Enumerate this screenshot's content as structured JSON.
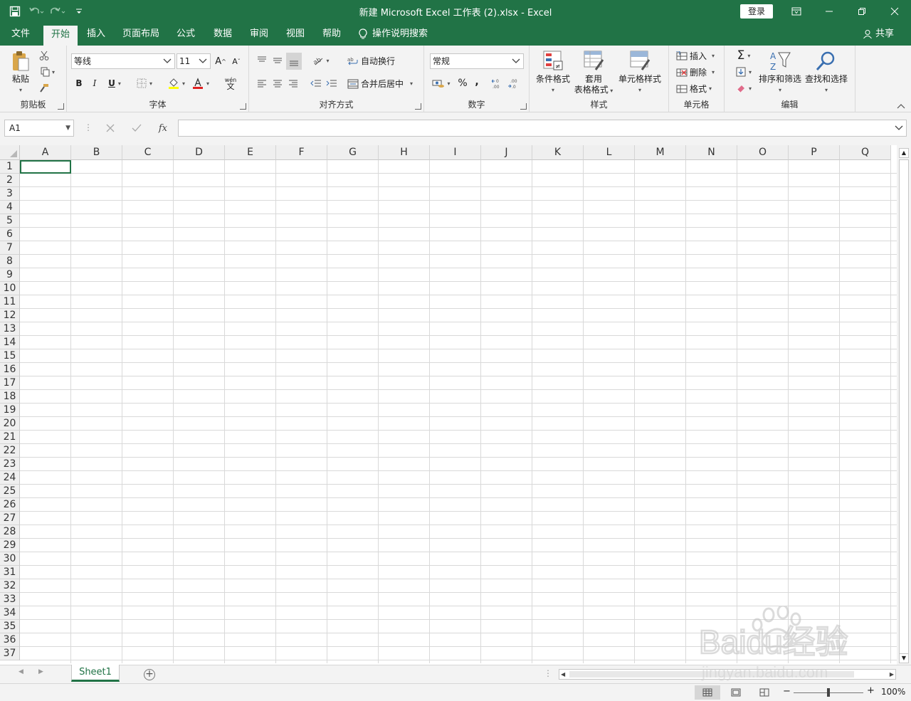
{
  "window": {
    "title": "新建 Microsoft Excel 工作表 (2).xlsx  -  Excel",
    "login_label": "登录"
  },
  "menu": {
    "tabs": [
      "文件",
      "开始",
      "插入",
      "页面布局",
      "公式",
      "数据",
      "审阅",
      "视图",
      "帮助"
    ],
    "active_tab": "开始",
    "search_label": "操作说明搜索",
    "share_label": "共享"
  },
  "ribbon": {
    "clipboard": {
      "label": "剪贴板",
      "paste_label": "粘贴"
    },
    "font": {
      "label": "字体",
      "font_name": "等线",
      "font_size": "11",
      "bold": "B",
      "italic": "I",
      "underline": "U",
      "grow": "A",
      "shrink": "A",
      "wen": "wén",
      "wen_char": "文"
    },
    "alignment": {
      "label": "对齐方式",
      "wrap_label": "自动换行",
      "merge_label": "合并后居中"
    },
    "number": {
      "label": "数字",
      "format": "常规",
      "percent": "%",
      "comma": ","
    },
    "styles": {
      "label": "样式",
      "conditional": "条件格式",
      "table_line1": "套用",
      "table_line2": "表格格式",
      "cell_styles": "单元格样式"
    },
    "cells": {
      "label": "单元格",
      "insert": "插入",
      "delete": "删除",
      "format": "格式"
    },
    "editing": {
      "label": "编辑",
      "sort_filter": "排序和筛选",
      "find_select": "查找和选择"
    }
  },
  "formula_bar": {
    "name_box": "A1",
    "formula": ""
  },
  "grid": {
    "columns": [
      "A",
      "B",
      "C",
      "D",
      "E",
      "F",
      "G",
      "H",
      "I",
      "J",
      "K",
      "L",
      "M",
      "N",
      "O",
      "P",
      "Q"
    ],
    "rows": [
      "1",
      "2",
      "3",
      "4",
      "5",
      "6",
      "7",
      "8",
      "9",
      "10",
      "11",
      "12",
      "13",
      "14",
      "15",
      "16",
      "17",
      "18",
      "19",
      "20",
      "21",
      "22",
      "23",
      "24",
      "25",
      "26",
      "27",
      "28",
      "29",
      "30",
      "31",
      "32",
      "33",
      "34",
      "35",
      "36",
      "37"
    ]
  },
  "sheets": {
    "tabs": [
      "Sheet1"
    ],
    "active": "Sheet1"
  },
  "status": {
    "zoom": "100%"
  },
  "watermark": {
    "text": "Baidu经验",
    "url": "jingyan.baidu.com"
  },
  "colors": {
    "accent": "#217346",
    "ribbon_bg": "#f3f3f3",
    "gridline": "#d9d9d9"
  }
}
